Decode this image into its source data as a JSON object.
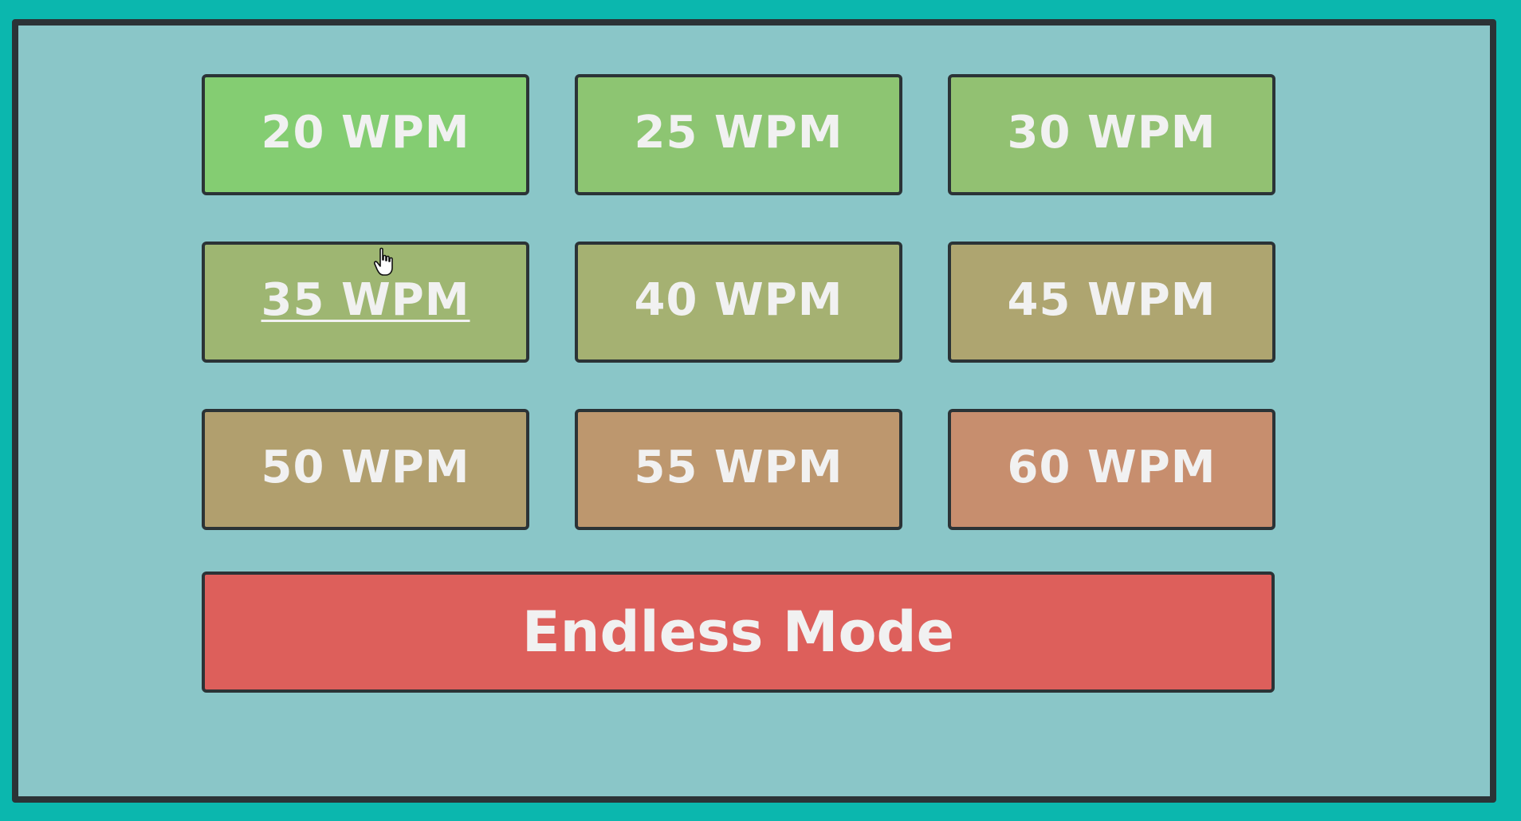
{
  "buttons": [
    {
      "label": "20 WPM",
      "color": "#84cd72"
    },
    {
      "label": "25 WPM",
      "color": "#8dc572"
    },
    {
      "label": "30 WPM",
      "color": "#92c172"
    },
    {
      "label": "35 WPM",
      "color": "#9eb672"
    },
    {
      "label": "40 WPM",
      "color": "#a5b172"
    },
    {
      "label": "45 WPM",
      "color": "#aea570"
    },
    {
      "label": "50 WPM",
      "color": "#b19f6e"
    },
    {
      "label": "55 WPM",
      "color": "#bd976e"
    },
    {
      "label": "60 WPM",
      "color": "#c78e6e"
    }
  ],
  "endless": {
    "label": "Endless Mode",
    "color": "#dd5f5b"
  },
  "hovered_index": 3,
  "colors": {
    "page_background": "#0bb7ae",
    "panel_background": "#8ac6c8",
    "border": "#2b3336",
    "text": "#f1f1f1"
  },
  "cursor_icon": "hand-pointer-icon"
}
